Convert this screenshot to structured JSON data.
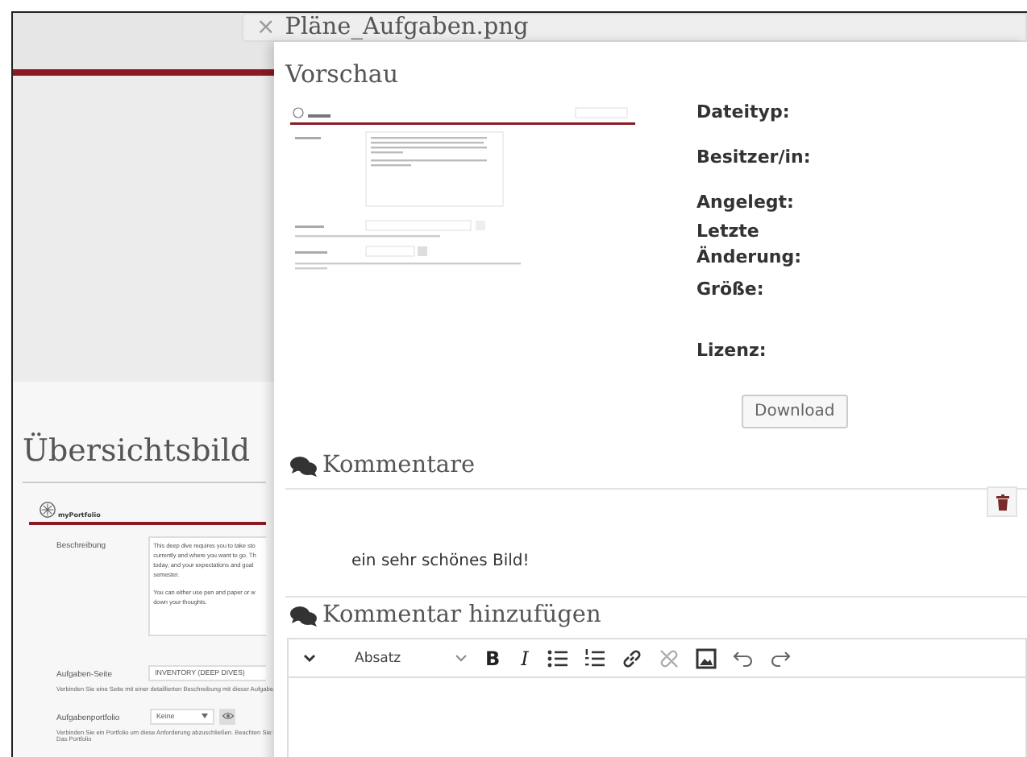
{
  "background_page": {
    "heading": "Übersichtsbild",
    "preview": {
      "logo": "myPortfolio",
      "fields": [
        {
          "kind": "textarea",
          "label": "Beschreibung",
          "paragraphs": [
            [
              "This deep dive requires you to take sto",
              "currently and where you want to go. Th",
              "today, and your expectations and goal",
              "semester."
            ],
            [
              "You can either use pen and paper or w",
              "down your thoughts."
            ]
          ]
        },
        {
          "kind": "select",
          "label": "Aufgaben-Seite",
          "value": "INVENTORY (DEEP DIVES)",
          "hint": "Verbinden Sie eine Seite mit einer detaillierten Beschreibung mit dieser Aufgabe."
        },
        {
          "kind": "select-button",
          "label": "Aufgabenportfolio",
          "value": "Keine",
          "hint": "Verbinden Sie ein Portfolio um diese Anforderung abzuschließen. Beachten Sie: Das Portfolio"
        }
      ]
    }
  },
  "dialog": {
    "title": "Pläne_Aufgaben.png",
    "close": "×",
    "preview": {
      "heading": "Vorschau"
    },
    "details": [
      {
        "label": "Dateityp:"
      },
      {
        "label": "Besitzer/in:"
      },
      {
        "label": "Angelegt:"
      },
      {
        "label": "Letzte Änderung:"
      },
      {
        "label": "Größe:"
      },
      {
        "label": "Lizenz:"
      }
    ],
    "download_button": "Download",
    "comments": {
      "heading": "Kommentare",
      "items": [
        {
          "text": "ein sehr schönes Bild!",
          "deletable": true
        }
      ]
    },
    "add_comment": {
      "heading": "Kommentar hinzufügen",
      "toolbar": [
        {
          "kind": "chevron"
        },
        {
          "kind": "format-select",
          "label": "Absatz"
        },
        {
          "kind": "bold",
          "label": "B"
        },
        {
          "kind": "italic",
          "label": "I"
        },
        {
          "kind": "bullet-list"
        },
        {
          "kind": "numbered-list"
        },
        {
          "kind": "link"
        },
        {
          "kind": "unlink"
        },
        {
          "kind": "image"
        },
        {
          "kind": "undo"
        },
        {
          "kind": "redo"
        }
      ]
    }
  }
}
